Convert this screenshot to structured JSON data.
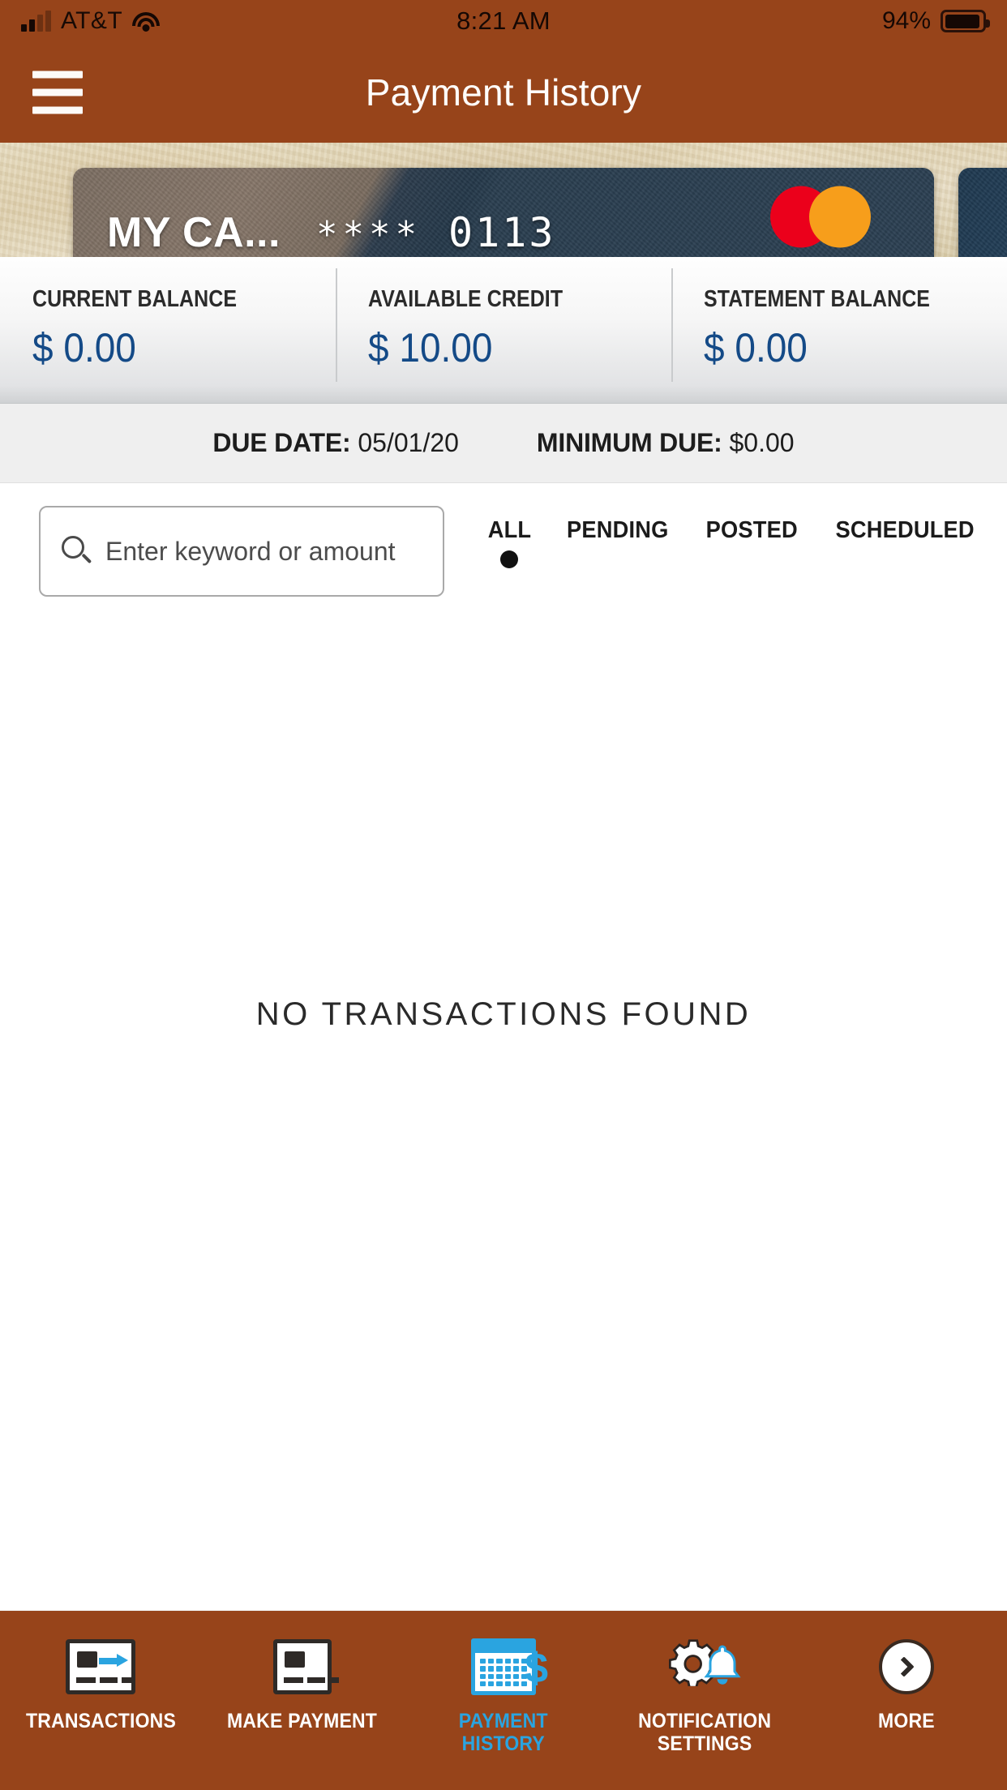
{
  "status_bar": {
    "carrier": "AT&T",
    "time": "8:21 AM",
    "battery_percent": "94%"
  },
  "header": {
    "title": "Payment History",
    "menu_icon": "hamburger-icon",
    "background_color": "#97441a"
  },
  "card": {
    "name": "MY CA...",
    "masked": "****",
    "last_four": "0113",
    "brand": "mastercard"
  },
  "balances": [
    {
      "label": "CURRENT BALANCE",
      "value": "$ 0.00"
    },
    {
      "label": "AVAILABLE CREDIT",
      "value": "$ 10.00"
    },
    {
      "label": "STATEMENT BALANCE",
      "value": "$ 0.00"
    }
  ],
  "balance_value_color": "#144a87",
  "due": {
    "due_date_label": "DUE DATE:",
    "due_date_value": "05/01/20",
    "minimum_due_label": "MINIMUM DUE:",
    "minimum_due_value": "$0.00"
  },
  "search": {
    "placeholder": "Enter keyword or amount",
    "value": "",
    "icon": "search-icon"
  },
  "filters": {
    "tabs": [
      {
        "label": "ALL",
        "active": true
      },
      {
        "label": "PENDING",
        "active": false
      },
      {
        "label": "POSTED",
        "active": false
      },
      {
        "label": "SCHEDULED",
        "active": false
      }
    ]
  },
  "content": {
    "empty_message": "NO TRANSACTIONS FOUND"
  },
  "bottom_nav": {
    "active_color": "#2aa4e0",
    "items": [
      {
        "label": "TRANSACTIONS",
        "icon": "card-arrow-icon",
        "active": false
      },
      {
        "label": "MAKE PAYMENT",
        "icon": "card-icon",
        "active": false
      },
      {
        "label": "PAYMENT\nHISTORY",
        "icon": "calendar-dollar-icon",
        "active": true
      },
      {
        "label": "NOTIFICATION\nSETTINGS",
        "icon": "gear-bell-icon",
        "active": false
      },
      {
        "label": "MORE",
        "icon": "chevron-right-circle-icon",
        "active": false
      }
    ]
  }
}
